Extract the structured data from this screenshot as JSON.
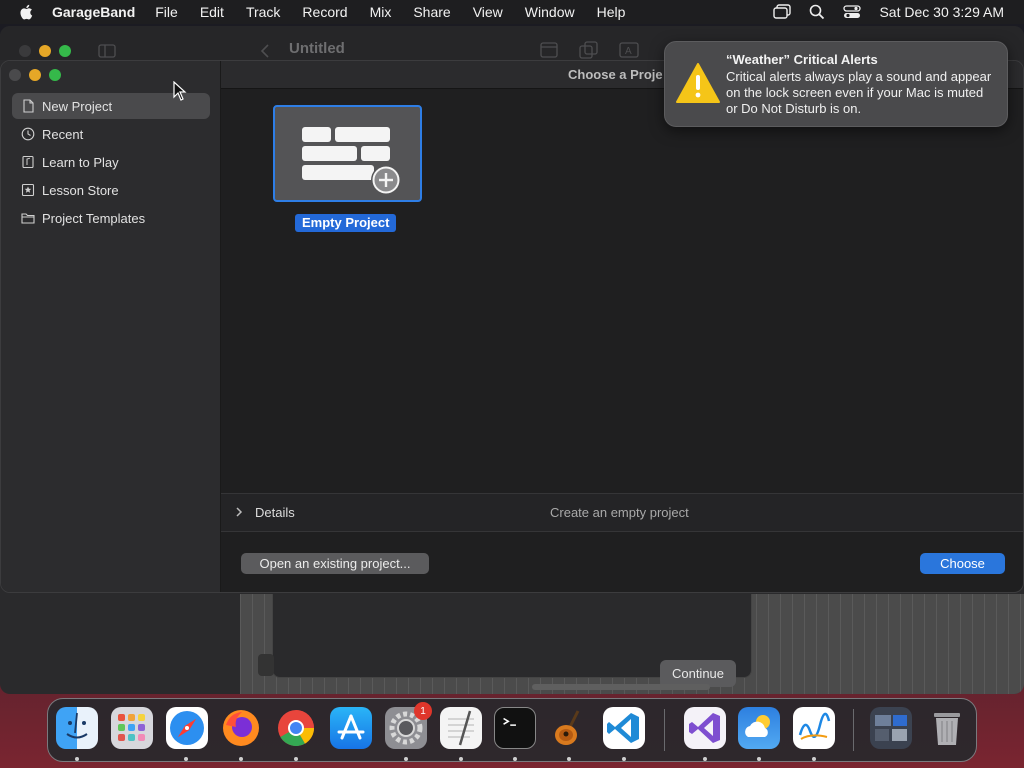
{
  "menubar": {
    "app_name": "GarageBand",
    "items": [
      "File",
      "Edit",
      "Track",
      "Record",
      "Mix",
      "Share",
      "View",
      "Window",
      "Help"
    ],
    "clock": "Sat Dec 30  3:29 AM"
  },
  "background_window": {
    "title": "Untitled",
    "continue_label": "Continue"
  },
  "dialog": {
    "title": "Choose a Proje",
    "sidebar": {
      "items": [
        {
          "label": "New Project",
          "icon": "document-icon",
          "selected": true
        },
        {
          "label": "Recent",
          "icon": "clock-icon",
          "selected": false
        },
        {
          "label": "Learn to Play",
          "icon": "music-book-icon",
          "selected": false
        },
        {
          "label": "Lesson Store",
          "icon": "star-box-icon",
          "selected": false
        },
        {
          "label": "Project Templates",
          "icon": "folder-icon",
          "selected": false
        }
      ]
    },
    "tile_label": "Empty Project",
    "details_label": "Details",
    "details_description": "Create an empty project",
    "open_existing_label": "Open an existing project...",
    "choose_label": "Choose"
  },
  "notification": {
    "title": "“Weather” Critical Alerts",
    "body": "Critical alerts always play a sound and appear on the lock screen even if your Mac is muted or Do Not Disturb is on."
  },
  "dock": {
    "apps": [
      "Finder",
      "Launchpad",
      "Safari",
      "Firefox",
      "Chrome",
      "App Store",
      "System Settings",
      "TextEdit",
      "Terminal",
      "GarageBand",
      "Visual Studio Code",
      "Visual Studio",
      "Weather",
      "Freeform",
      "Downloads",
      "Trash"
    ],
    "settings_badge": "1"
  },
  "colors": {
    "accent": "#2a76dc",
    "selection": "#2369d8",
    "warning": "#f5c518",
    "badge": "#e0362b"
  }
}
